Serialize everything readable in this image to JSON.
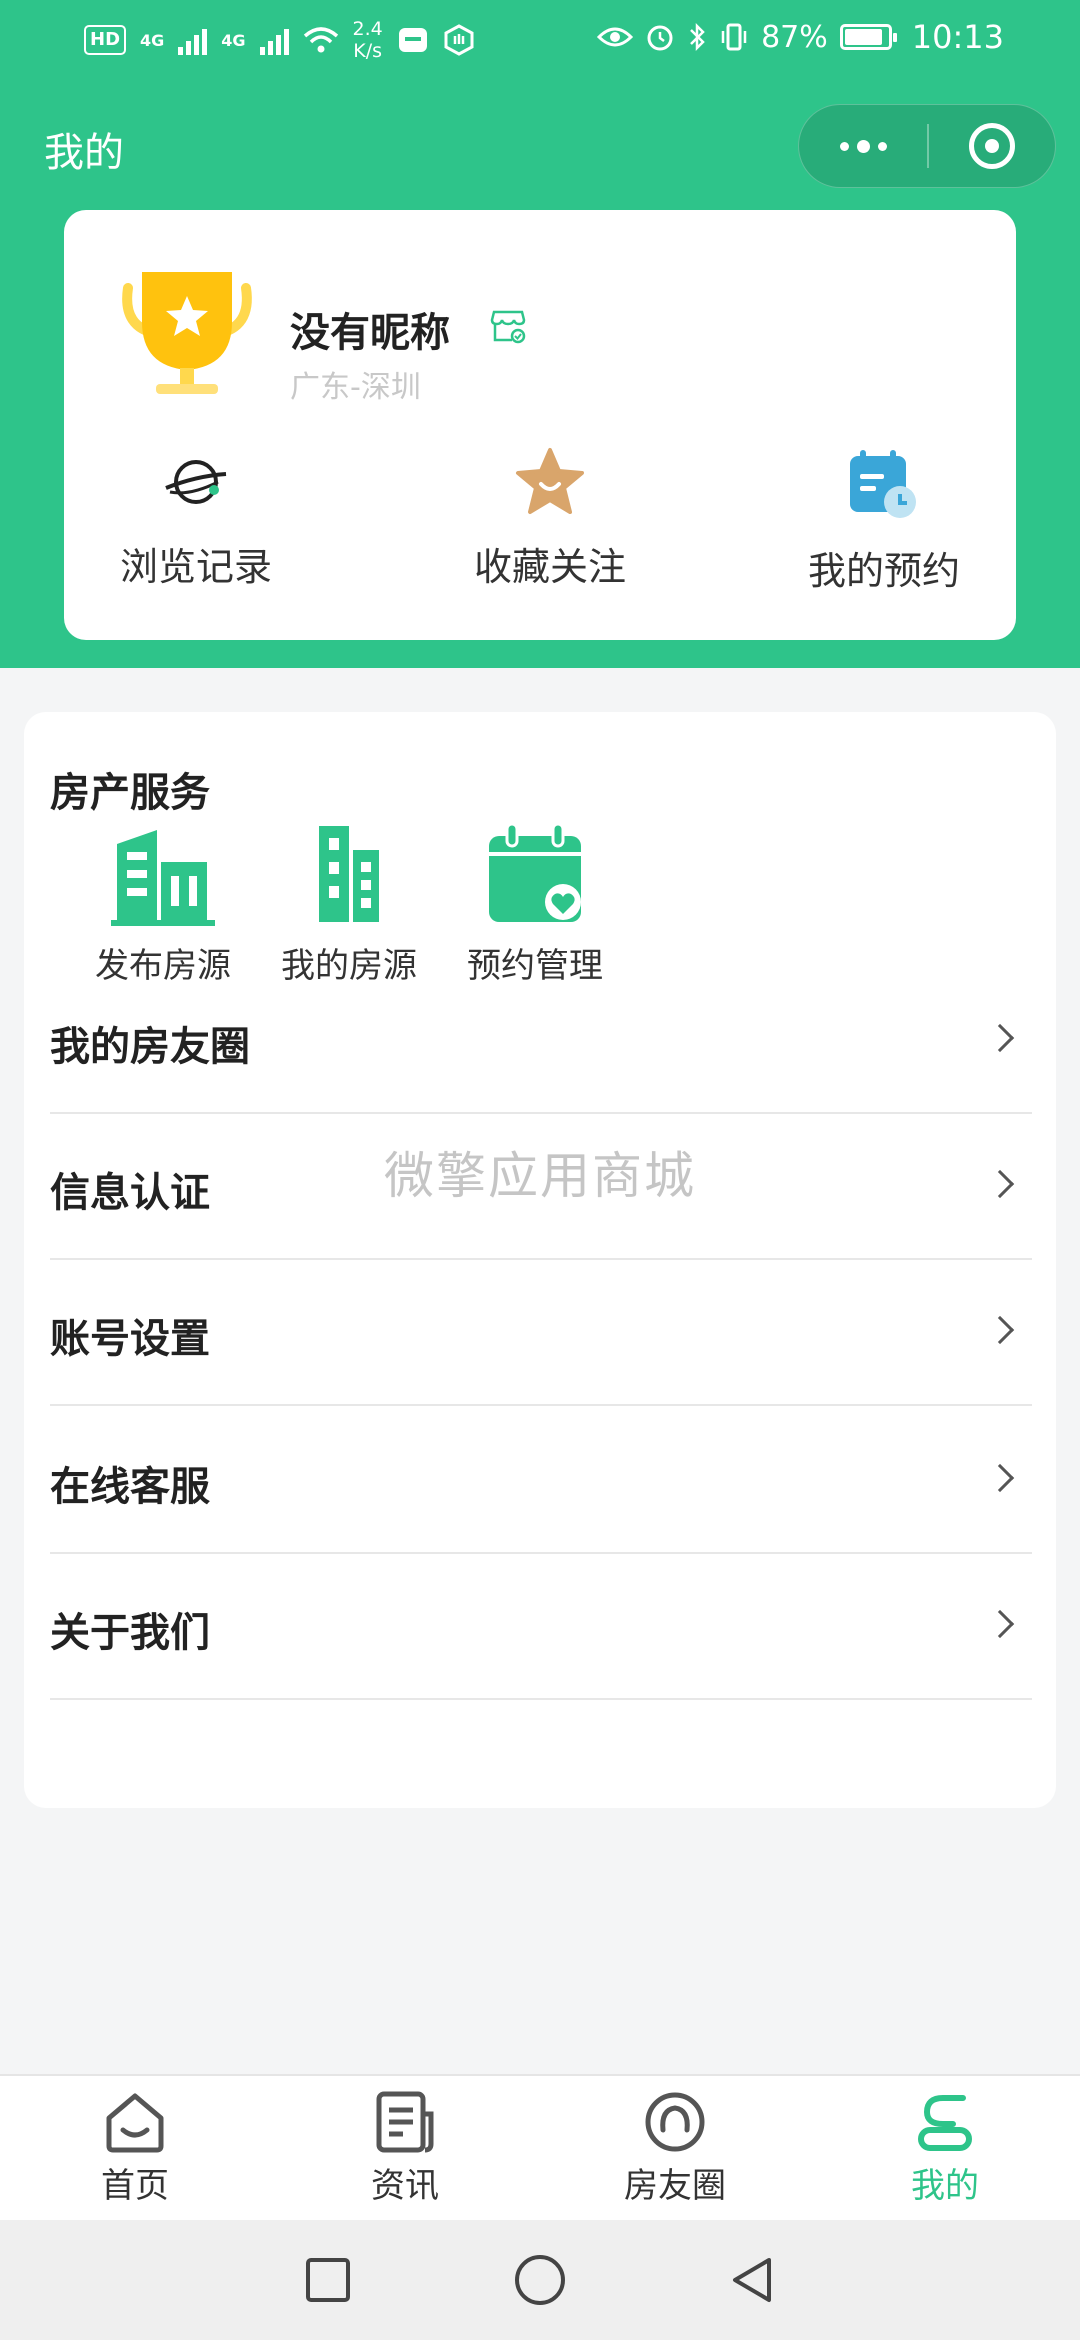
{
  "status_bar": {
    "badge": "HD",
    "network_1": "4G",
    "network_2": "4G",
    "speed": "2.4\nK/s",
    "battery": "87%",
    "time": "10:13"
  },
  "header": {
    "title": "我的"
  },
  "profile": {
    "nickname": "没有昵称",
    "location": "广东-深圳",
    "quick_actions": [
      {
        "label": "浏览记录",
        "icon": "planet-icon"
      },
      {
        "label": "收藏关注",
        "icon": "star-icon"
      },
      {
        "label": "我的预约",
        "icon": "calendar-clock-icon"
      }
    ]
  },
  "services": {
    "title": "房产服务",
    "items": [
      {
        "label": "发布房源",
        "icon": "building-icon"
      },
      {
        "label": "我的房源",
        "icon": "tower-icon"
      },
      {
        "label": "预约管理",
        "icon": "calendar-check-icon"
      }
    ]
  },
  "menu": [
    {
      "label": "我的房友圈"
    },
    {
      "label": "信息认证"
    },
    {
      "label": "账号设置"
    },
    {
      "label": "在线客服"
    },
    {
      "label": "关于我们"
    }
  ],
  "watermark": "微擎应用商城",
  "tab_bar": [
    {
      "label": "首页",
      "icon": "home-icon"
    },
    {
      "label": "资讯",
      "icon": "news-icon"
    },
    {
      "label": "房友圈",
      "icon": "circle-icon"
    },
    {
      "label": "我的",
      "icon": "profile-icon",
      "active": true
    }
  ],
  "colors": {
    "brand_green": "#2ec48a",
    "trophy_gold": "#ffc20e",
    "star_tan": "#d9a56b",
    "calendar_blue": "#3aa6d8"
  }
}
